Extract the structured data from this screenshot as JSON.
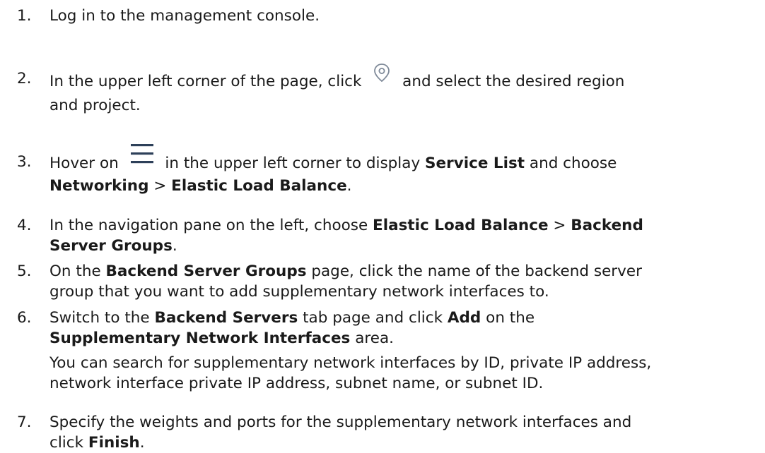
{
  "steps": [
    {
      "num": "1.",
      "text": "Log in to the management console."
    },
    {
      "num": "2.",
      "pre": "In the upper left corner of the page, click",
      "post": "and select the desired region",
      "line2": "and project.",
      "icon": "location-pin-icon"
    },
    {
      "num": "3.",
      "a": "Hover on",
      "b": "in the upper left corner to display",
      "c": "Service List",
      "d": "and choose",
      "e": "Networking",
      "f": ">",
      "g": "Elastic Load Balance",
      "h": ".",
      "icon": "menu-icon"
    },
    {
      "num": "4.",
      "a": "In the navigation pane on the left, choose",
      "b": "Elastic Load Balance",
      "c": ">",
      "d": "Backend",
      "e": "Server Groups",
      "f": "."
    },
    {
      "num": "5.",
      "a": "On the",
      "b": "Backend Server Groups",
      "c": "page, click the name of the backend server",
      "d": "group that you want to add supplementary network interfaces to."
    },
    {
      "num": "6.",
      "a": "Switch to the",
      "b": "Backend Servers",
      "c": "tab page and click",
      "d": "Add",
      "e": "on the",
      "f": "Supplementary Network Interfaces",
      "g": "area.",
      "note1": "You can search for supplementary network interfaces by ID, private IP address,",
      "note2": "network interface private IP address, subnet name, or subnet ID."
    },
    {
      "num": "7.",
      "a": "Specify the weights and ports for the supplementary network interfaces and",
      "b": "click",
      "c": "Finish",
      "d": "."
    }
  ]
}
